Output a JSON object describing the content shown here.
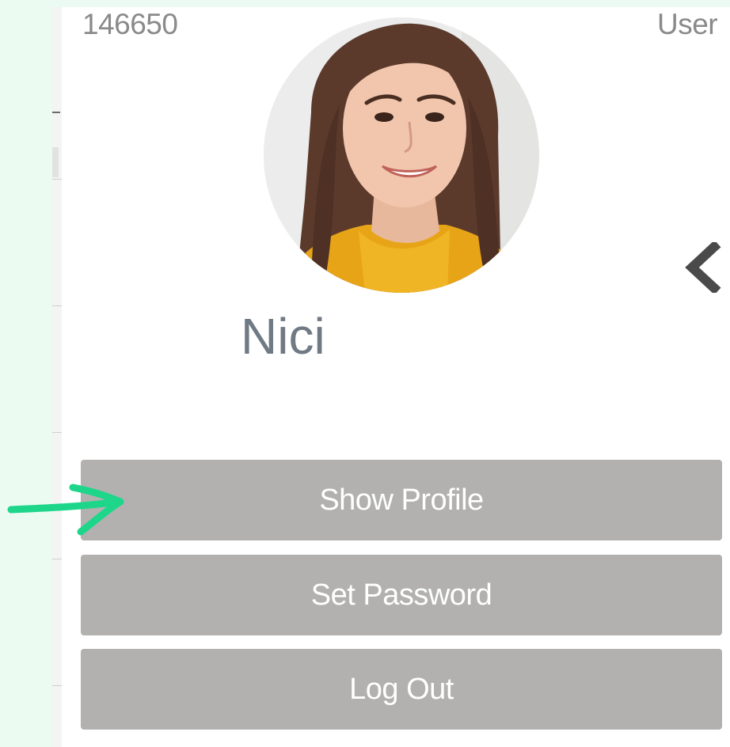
{
  "header": {
    "user_id": "146650",
    "user_label": "User"
  },
  "profile": {
    "name": "Nici",
    "avatar_icon": "user-photo"
  },
  "menu": {
    "show_profile": "Show Profile",
    "set_password": "Set Password",
    "log_out": "Log Out"
  },
  "icons": {
    "collapse": "chevron-left-icon",
    "annotation": "arrow-right-icon"
  },
  "colors": {
    "background": "#ebfbf1",
    "button": "#b2b1b0",
    "button_text": "#ffffff",
    "name_text": "#707a84",
    "annotation_arrow": "#1ed68a"
  }
}
